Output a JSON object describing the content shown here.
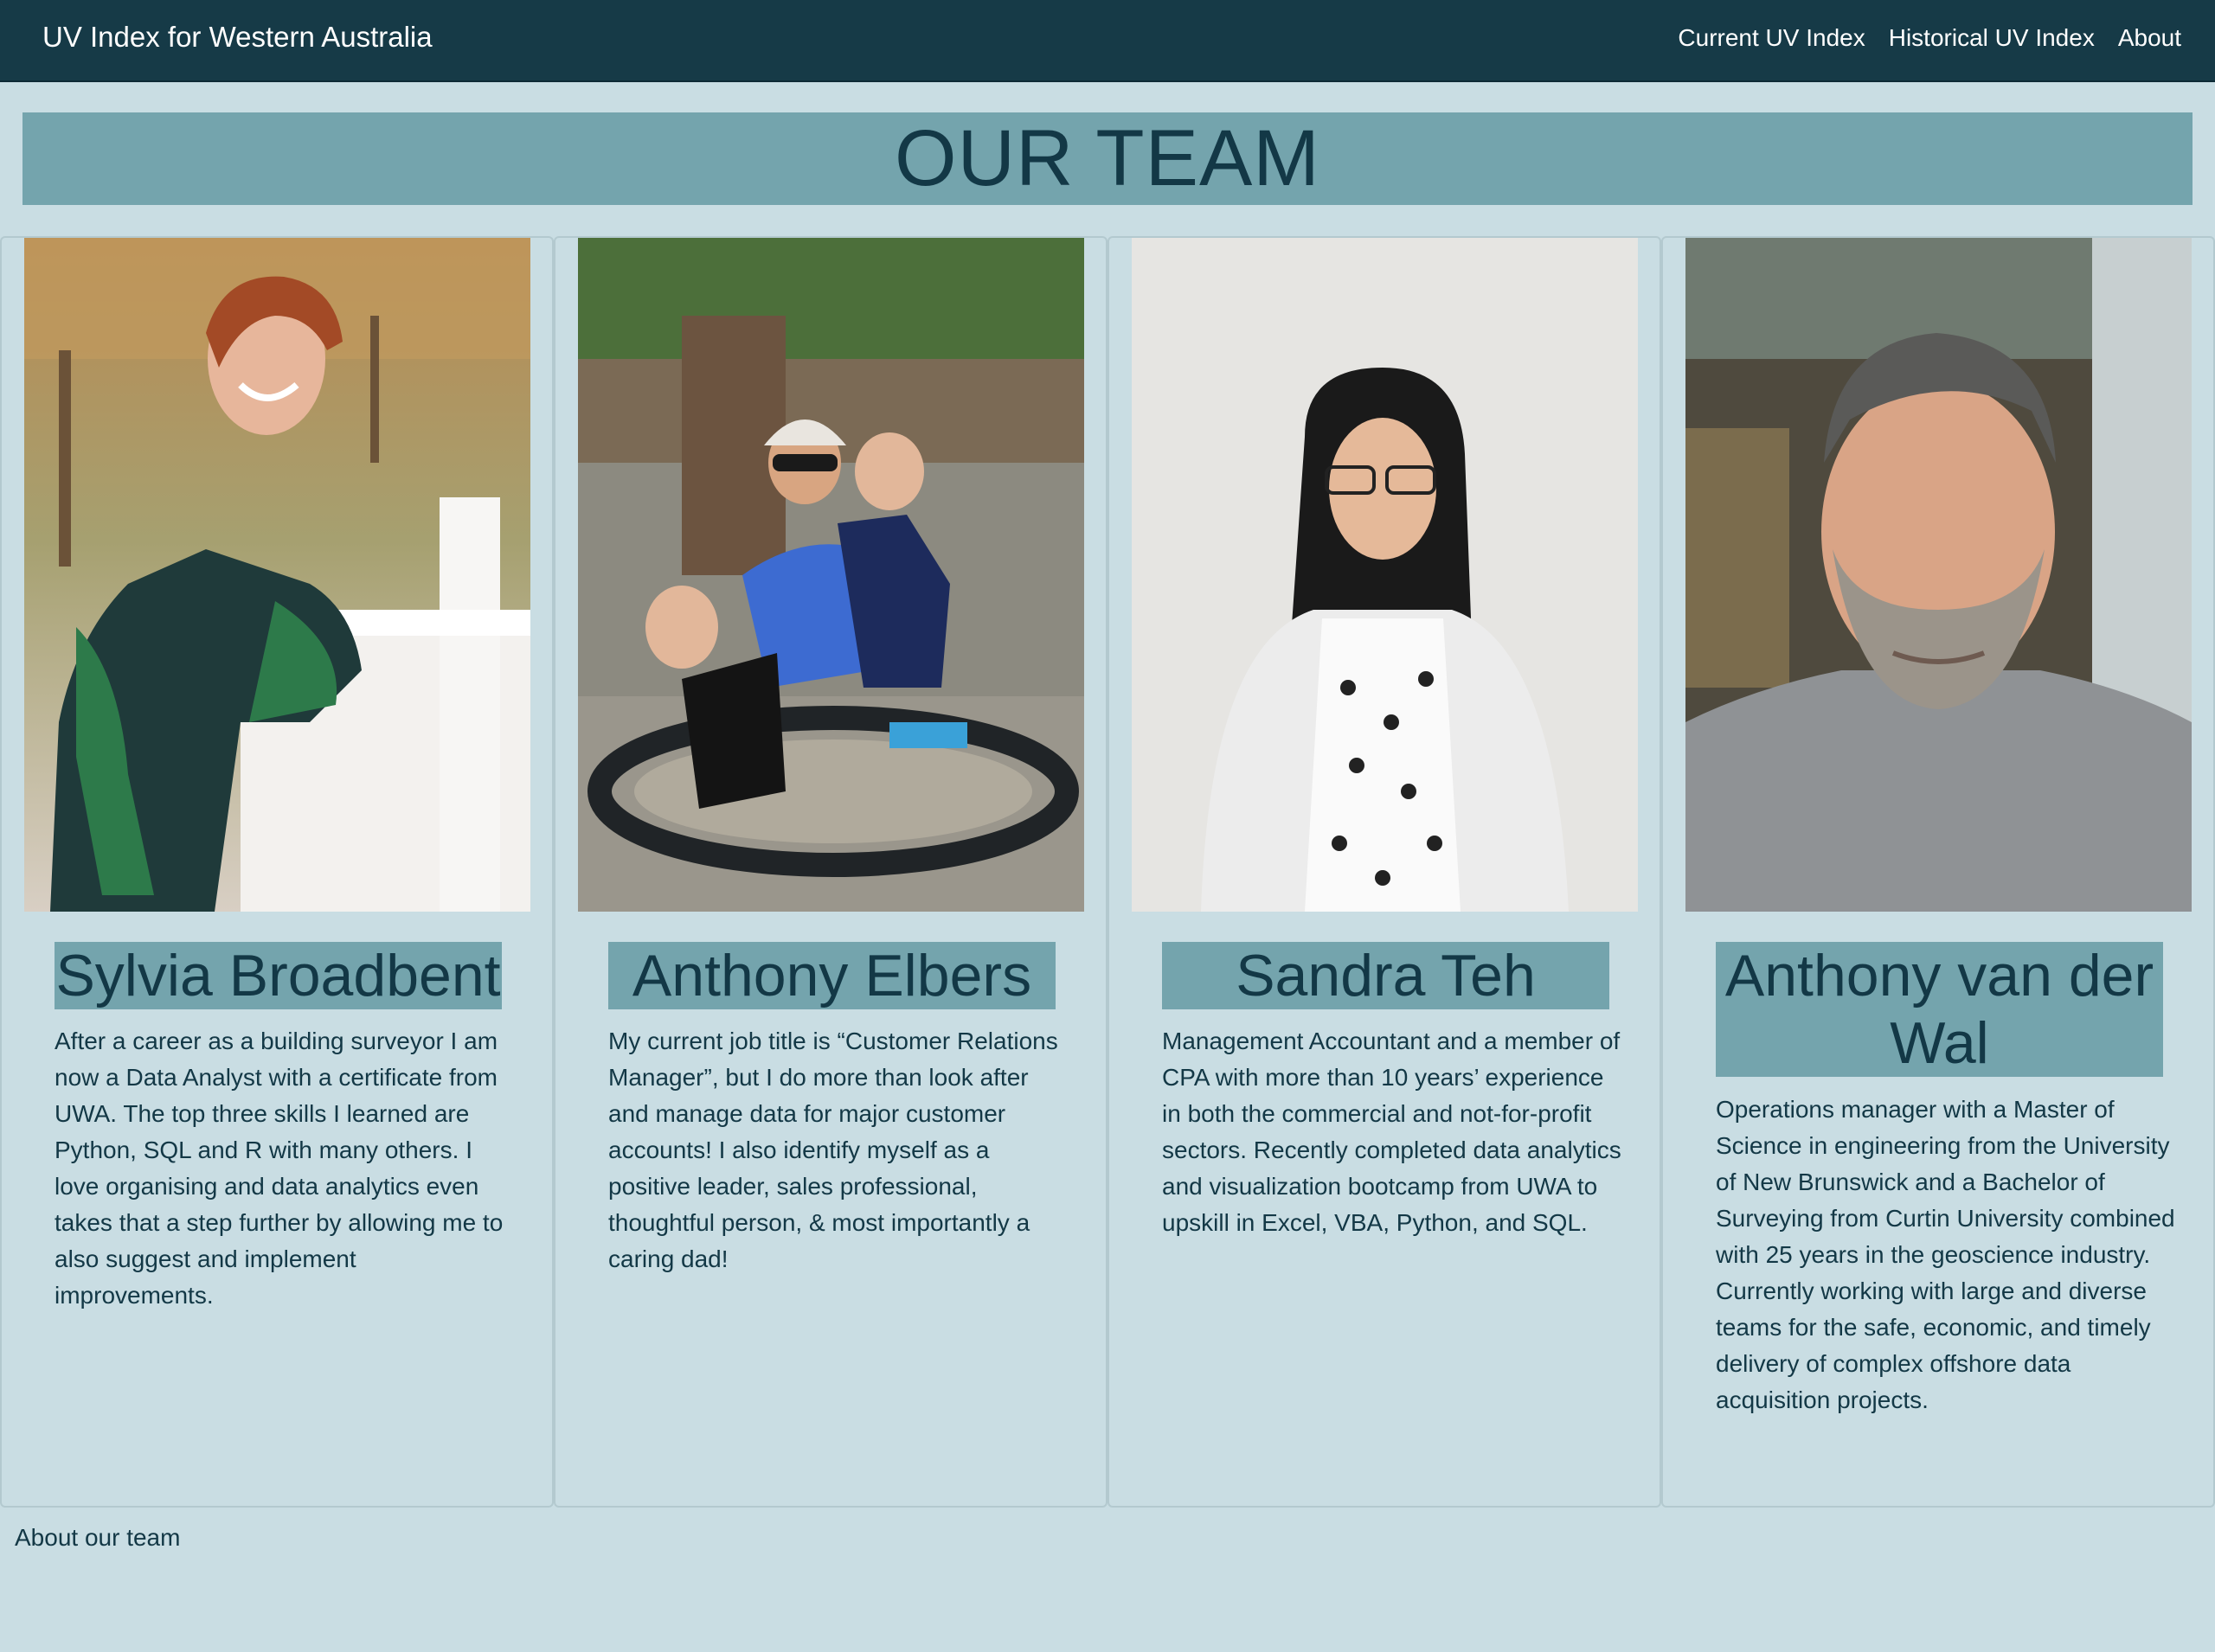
{
  "navbar": {
    "brand": "UV Index for Western Australia",
    "links": [
      "Current UV Index",
      "Historical UV Index",
      "About"
    ]
  },
  "banner": {
    "title": "OUR TEAM"
  },
  "team": [
    {
      "name": "Sylvia Broadbent",
      "bio": "After a career as a building surveyor I am now a Data Analyst with a certificate from UWA. The top three skills I learned are Python, SQL and R with many others. I love organising and data analytics even takes that a step further by allowing me to also suggest and implement improvements."
    },
    {
      "name": "Anthony Elbers",
      "bio": "My current job title is “Customer Relations Manager”, but I do more than look after and manage data for major customer accounts! I also identify myself as a positive leader, sales professional, thoughtful person, & most importantly a caring dad!"
    },
    {
      "name": "Sandra Teh",
      "bio": "Management Accountant and a member of CPA with more than 10 years’ experience in both the commercial and not-for-profit sectors. Recently completed data analytics and visualization bootcamp from UWA to upskill in Excel, VBA, Python, and SQL."
    },
    {
      "name": "Anthony van der Wal",
      "bio": "Operations manager with a Master of Science in engineering from the University of New Brunswick and a Bachelor of Surveying from Curtin University combined with 25 years in the geoscience industry. Currently working with large and diverse teams for the safe, economic, and timely delivery of complex offshore data acquisition projects."
    }
  ],
  "footer": {
    "text": "About our team"
  },
  "colors": {
    "navbar": "#163a47",
    "page_background": "#c9dde3",
    "banner": "#74a4ad",
    "text": "#133846"
  }
}
